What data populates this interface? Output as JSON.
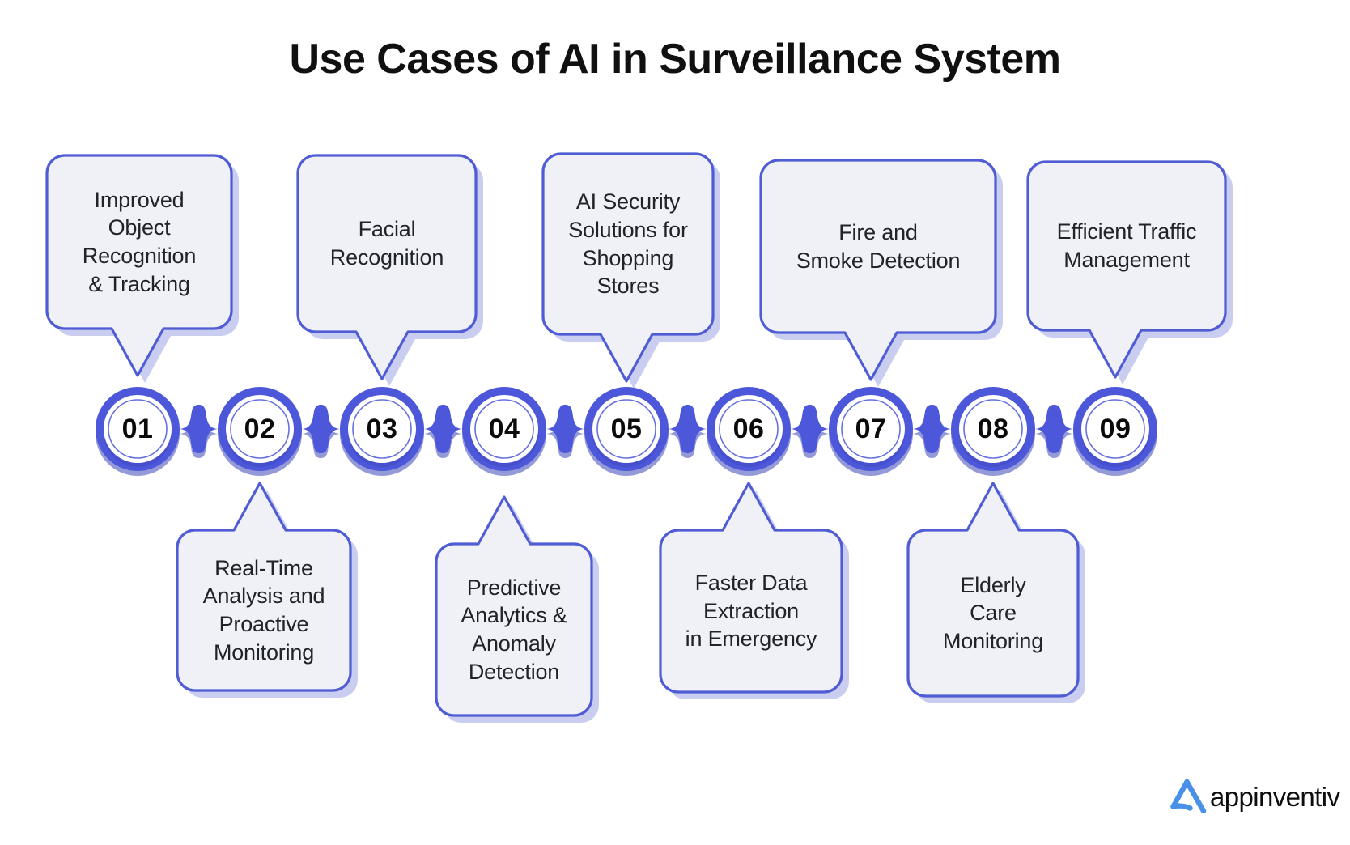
{
  "title": "Use Cases of AI in Surveillance System",
  "colors": {
    "chain_blue": "#4c57d9",
    "chain_shadow": "#3d46b8",
    "card_fill": "#eff1f7",
    "card_border": "#4f5cd4",
    "card_shadow": "#c9cef1",
    "text_dark": "#20232a",
    "title_black": "#101010",
    "logo_blue": "#4a90e8"
  },
  "steps": [
    {
      "number": "01",
      "label": "Improved\nObject\nRecognition\n& Tracking",
      "position": "top"
    },
    {
      "number": "02",
      "label": "Real-Time\nAnalysis and\nProactive\nMonitoring",
      "position": "bottom"
    },
    {
      "number": "03",
      "label": "Facial\nRecognition",
      "position": "top"
    },
    {
      "number": "04",
      "label": "Predictive\nAnalytics &\nAnomaly\nDetection",
      "position": "bottom"
    },
    {
      "number": "05",
      "label": "AI Security\nSolutions for\nShopping\nStores",
      "position": "top"
    },
    {
      "number": "06",
      "label": "Faster Data\nExtraction\nin Emergency",
      "position": "bottom"
    },
    {
      "number": "07",
      "label": "Fire and\nSmoke Detection",
      "position": "top"
    },
    {
      "number": "08",
      "label": "Elderly\nCare\nMonitoring",
      "position": "bottom"
    },
    {
      "number": "09",
      "label": "Efficient Traffic\nManagement",
      "position": "top"
    }
  ],
  "logo": {
    "name": "appinventiv",
    "mark": "appinventiv-a-mark-icon"
  }
}
